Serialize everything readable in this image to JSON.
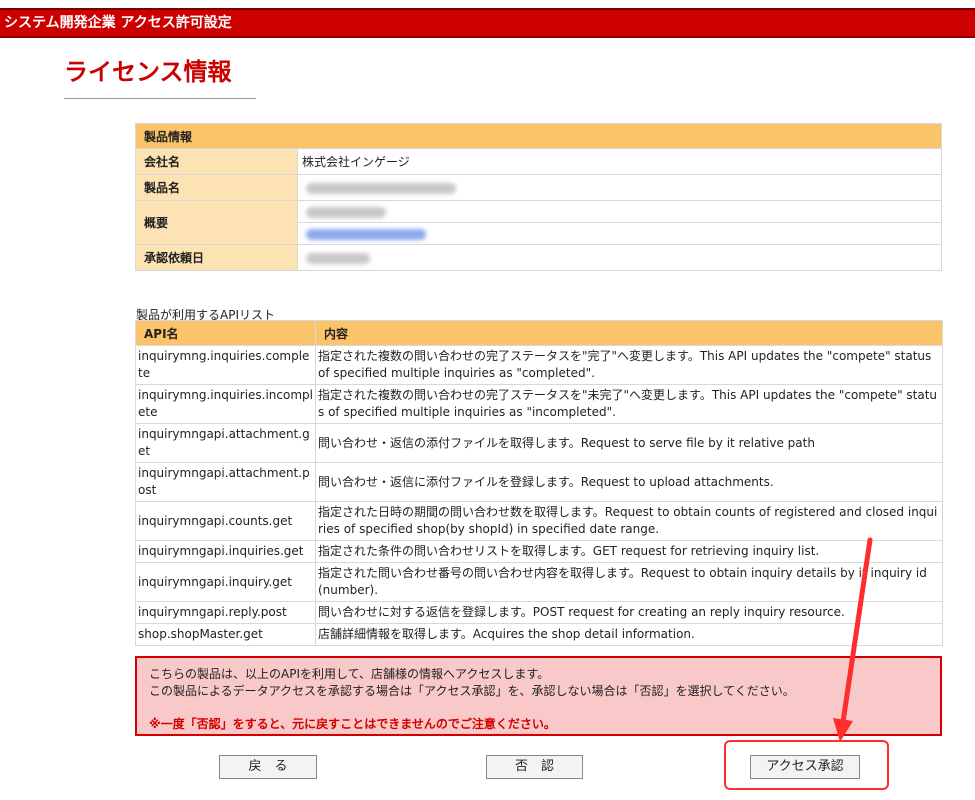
{
  "header": {
    "title": "システム開発企業 アクセス許可設定"
  },
  "page": {
    "title": "ライセンス情報"
  },
  "product_info": {
    "section_title": "製品情報",
    "rows": [
      {
        "label": "会社名",
        "value": "株式会社インゲージ"
      },
      {
        "label": "製品名",
        "value": ""
      },
      {
        "label": "概要",
        "value": ""
      },
      {
        "label": "承認依頼日",
        "value": ""
      }
    ]
  },
  "api_list": {
    "caption": "製品が利用するAPIリスト",
    "col_name": "API名",
    "col_desc": "内容",
    "rows": [
      {
        "name": "inquirymng.inquiries.complete",
        "desc": "指定された複数の問い合わせの完了ステータスを\"完了\"へ変更します。This API updates the \"compete\" status of specified multiple inquiries as \"completed\"."
      },
      {
        "name": "inquirymng.inquiries.incomplete",
        "desc": "指定された複数の問い合わせの完了ステータスを\"未完了\"へ変更します。This API updates the \"compete\" status of specified multiple inquiries as \"incompleted\"."
      },
      {
        "name": "inquirymngapi.attachment.get",
        "desc": "問い合わせ・返信の添付ファイルを取得します。Request to serve file by it relative path"
      },
      {
        "name": "inquirymngapi.attachment.post",
        "desc": "問い合わせ・返信に添付ファイルを登録します。Request to upload attachments."
      },
      {
        "name": "inquirymngapi.counts.get",
        "desc": "指定された日時の期間の問い合わせ数を取得します。Request to obtain counts of registered and closed inquiries of specified shop(by shopId) in specified date range."
      },
      {
        "name": "inquirymngapi.inquiries.get",
        "desc": "指定された条件の問い合わせリストを取得します。GET request for retrieving inquiry list."
      },
      {
        "name": "inquirymngapi.inquiry.get",
        "desc": "指定された問い合わせ番号の問い合わせ内容を取得します。Request to obtain inquiry details by it inquiry id (number)."
      },
      {
        "name": "inquirymngapi.reply.post",
        "desc": "問い合わせに対する返信を登録します。POST request for creating an reply inquiry resource."
      },
      {
        "name": "shop.shopMaster.get",
        "desc": "店舗詳細情報を取得します。Acquires the shop detail information."
      }
    ]
  },
  "notice": {
    "line1": "こちらの製品は、以上のAPIを利用して、店舗様の情報へアクセスします。",
    "line2": "この製品によるデータアクセスを承認する場合は「アクセス承認」を、承認しない場合は「否認」を選択してください。",
    "warning": "※一度「否認」をすると、元に戻すことはできませんのでご注意ください。"
  },
  "buttons": {
    "back": "戻　る",
    "deny": "否　認",
    "approve": "アクセス承認"
  },
  "colors": {
    "brand_red": "#cc0000",
    "header_orange": "#fbc36a",
    "label_peach": "#fde2b4",
    "notice_pink": "#f9c9c9"
  }
}
